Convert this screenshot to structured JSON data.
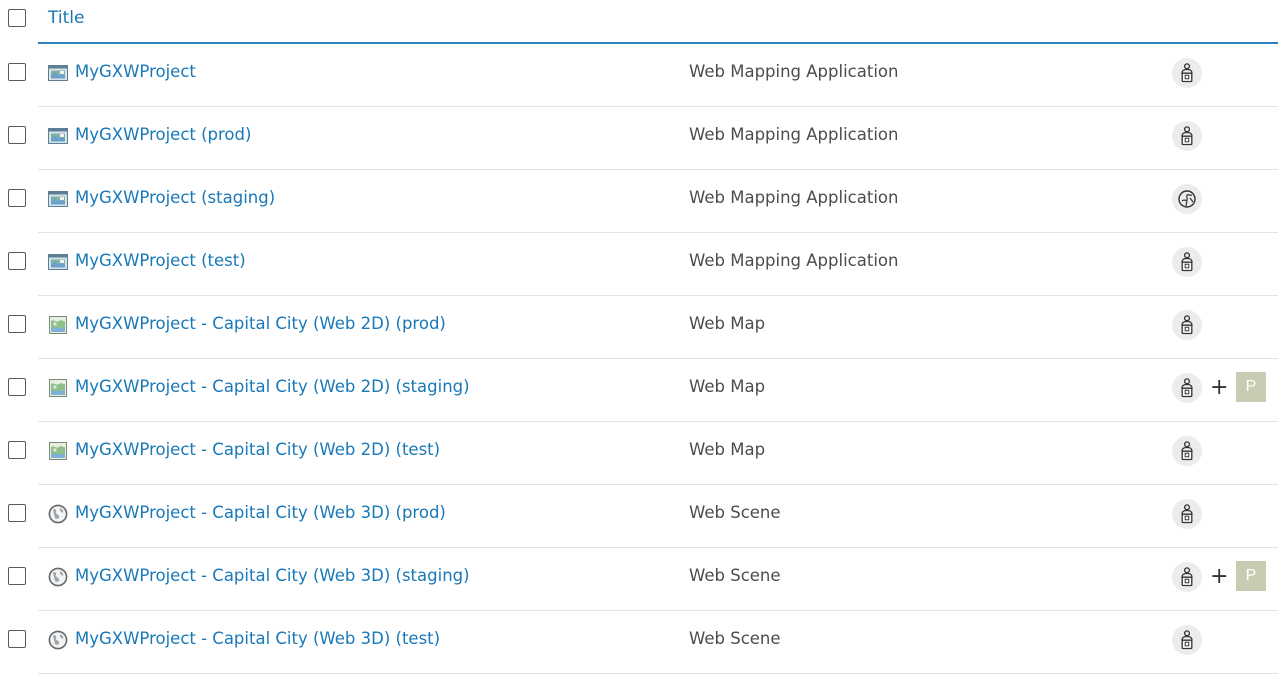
{
  "header": {
    "title_label": "Title"
  },
  "items": [
    {
      "title": "MyGXWProject",
      "type": "Web Mapping Application",
      "type_icon": "web-app-icon",
      "sharing": "private",
      "badge": ""
    },
    {
      "title": "MyGXWProject (prod)",
      "type": "Web Mapping Application",
      "type_icon": "web-app-icon",
      "sharing": "private",
      "badge": ""
    },
    {
      "title": "MyGXWProject (staging)",
      "type": "Web Mapping Application",
      "type_icon": "web-app-icon",
      "sharing": "public",
      "badge": ""
    },
    {
      "title": "MyGXWProject (test)",
      "type": "Web Mapping Application",
      "type_icon": "web-app-icon",
      "sharing": "private",
      "badge": ""
    },
    {
      "title": "MyGXWProject - Capital City (Web 2D) (prod)",
      "type": "Web Map",
      "type_icon": "web-map-icon",
      "sharing": "private",
      "badge": ""
    },
    {
      "title": "MyGXWProject - Capital City (Web 2D) (staging)",
      "type": "Web Map",
      "type_icon": "web-map-icon",
      "sharing": "private",
      "plus": "+",
      "badge": "P"
    },
    {
      "title": "MyGXWProject - Capital City (Web 2D) (test)",
      "type": "Web Map",
      "type_icon": "web-map-icon",
      "sharing": "private",
      "badge": ""
    },
    {
      "title": "MyGXWProject - Capital City (Web 3D) (prod)",
      "type": "Web Scene",
      "type_icon": "web-scene-icon",
      "sharing": "private",
      "badge": ""
    },
    {
      "title": "MyGXWProject - Capital City (Web 3D) (staging)",
      "type": "Web Scene",
      "type_icon": "web-scene-icon",
      "sharing": "private",
      "plus": "+",
      "badge": "P"
    },
    {
      "title": "MyGXWProject - Capital City (Web 3D) (test)",
      "type": "Web Scene",
      "type_icon": "web-scene-icon",
      "sharing": "private",
      "badge": ""
    }
  ],
  "colors": {
    "link": "#1978b8",
    "header_rule": "#2d82bd",
    "text": "#4c4c4c",
    "row_divider": "#e3e3e3",
    "share_bg": "#ececec",
    "badge_bg": "#c9ccb3"
  }
}
